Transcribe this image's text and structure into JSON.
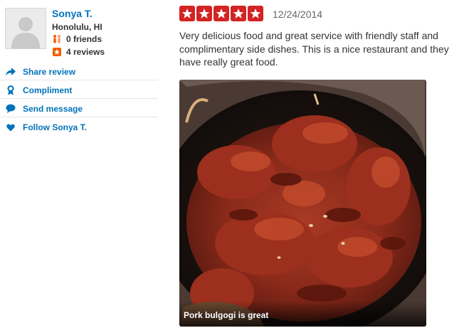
{
  "user": {
    "name": "Sonya T.",
    "location": "Honolulu, HI",
    "friends": "0 friends",
    "reviews": "4 reviews"
  },
  "actions": [
    {
      "label": "Share review",
      "icon": "share-arrow-icon"
    },
    {
      "label": "Compliment",
      "icon": "ribbon-icon"
    },
    {
      "label": "Send message",
      "icon": "speech-bubble-icon"
    },
    {
      "label": "Follow Sonya T.",
      "icon": "heart-icon"
    }
  ],
  "review": {
    "rating": 5,
    "max_rating": 5,
    "date": "12/24/2014",
    "text": "Very delicious food and great service with friendly staff and complimentary side dishes.  This is a nice restaurant and they have really great food.",
    "photo_caption": "Pork bulgogi is great"
  },
  "colors": {
    "link": "#0073bb",
    "star": "#d32323",
    "text": "#333333",
    "date": "#666666"
  }
}
